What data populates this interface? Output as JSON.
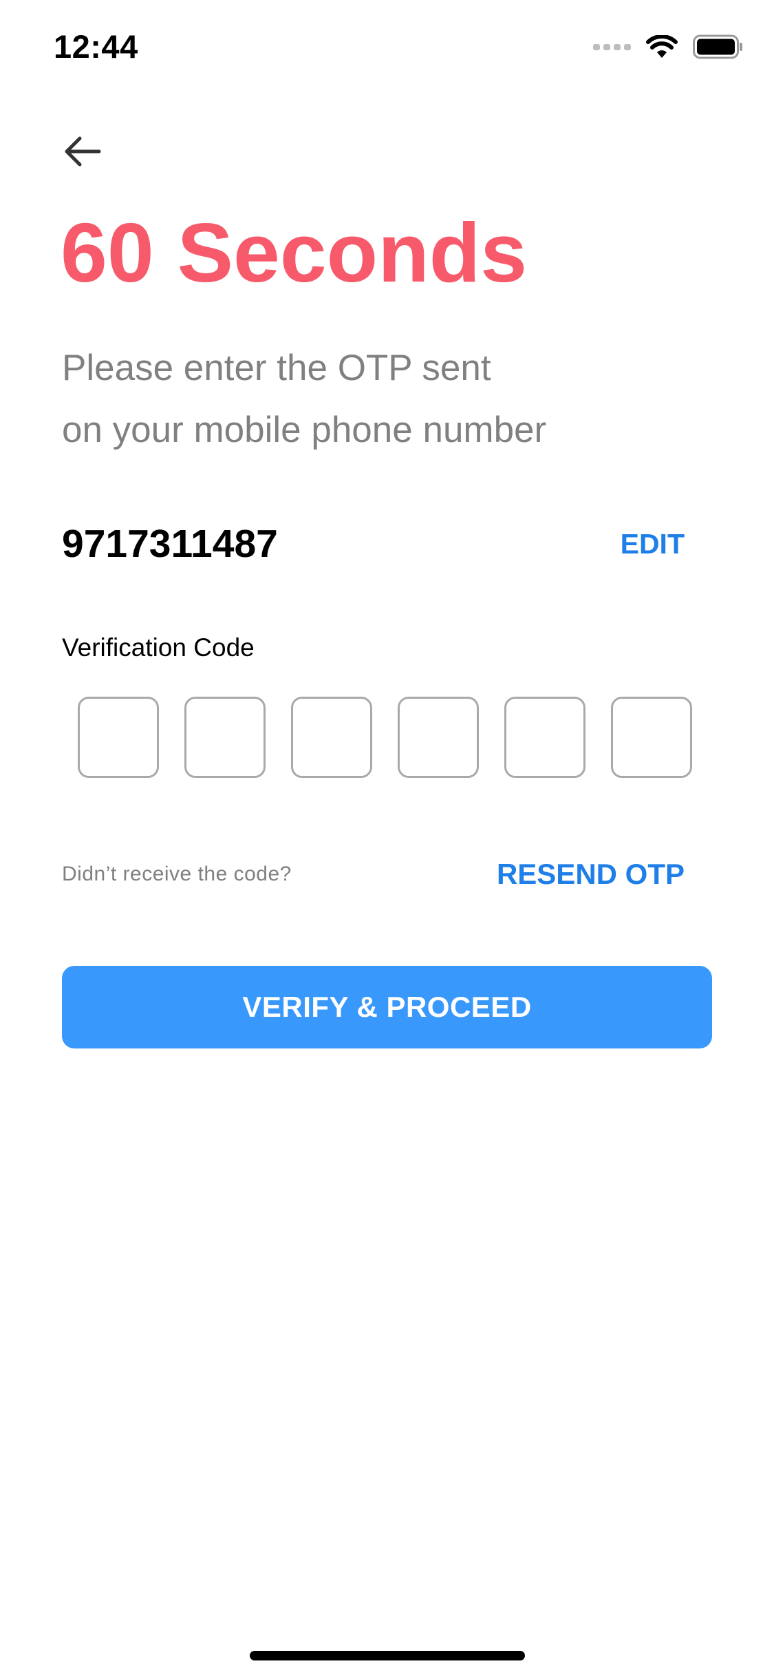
{
  "status_bar": {
    "time": "12:44",
    "icons": [
      "cellular-signal-icon",
      "wifi-icon",
      "battery-icon"
    ]
  },
  "header": {
    "back_icon": "arrow-left-icon",
    "timer_title": "60 Seconds",
    "subtitle_line1": "Please enter the OTP sent",
    "subtitle_line2": "on your mobile phone number"
  },
  "phone": {
    "number": "9717311487",
    "edit_label": "EDIT"
  },
  "verification": {
    "label": "Verification Code",
    "otp_boxes": [
      "",
      "",
      "",
      "",
      "",
      ""
    ]
  },
  "resend": {
    "prompt": "Didn’t receive the code?",
    "link_label": "RESEND OTP"
  },
  "actions": {
    "verify_label": "VERIFY & PROCEED"
  },
  "colors": {
    "title_red": "#f75a6a",
    "link_blue": "#1f7fe8",
    "button_blue": "#3898fc",
    "muted_gray": "#808080"
  }
}
